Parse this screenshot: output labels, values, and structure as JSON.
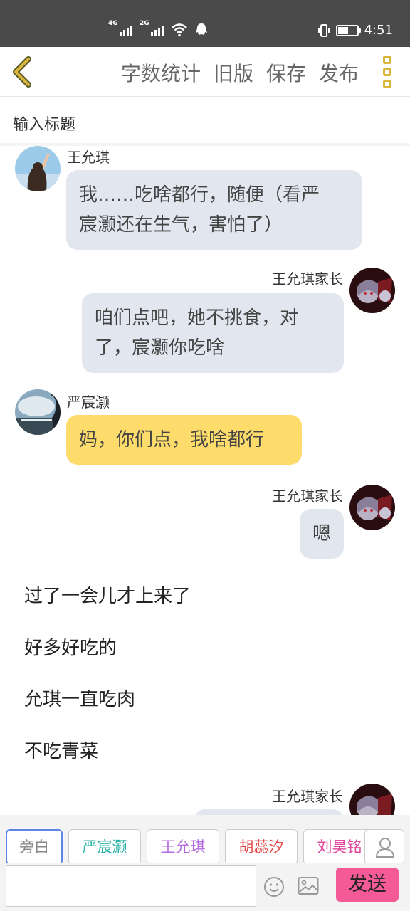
{
  "status_bar": {
    "sim1": "4G",
    "sim2": "2G",
    "time": "4:51",
    "battery_level": 0.55
  },
  "toolbar": {
    "back_icon": "chevron-left-icon",
    "word_count": "字数统计",
    "old_version": "旧版",
    "save": "保存",
    "publish": "发布",
    "more_icon": "more-vertical-icon",
    "accent_color": "#d9b53b"
  },
  "title_input": {
    "placeholder": "输入标题"
  },
  "chat": {
    "messages": [
      {
        "sender": "王允琪",
        "side": "left",
        "text_lines": [
          "我……吃啥都行，随便（看严",
          "宸灏还在生气，害怕了）"
        ],
        "bubble_color": "#e2e7ef"
      },
      {
        "sender": "王允琪家长",
        "side": "right",
        "text_lines": [
          "咱们点吧，她不挑食，对",
          "了，宸灏你吃啥"
        ],
        "bubble_color": "#e2e7ef"
      },
      {
        "sender": "严宸灏",
        "side": "left",
        "text_lines": [
          "妈，你们点，我啥都行"
        ],
        "bubble_color": "#fddc6c"
      },
      {
        "sender": "王允琪家长",
        "side": "right",
        "text_lines": [
          "嗯"
        ],
        "bubble_color": "#e2e7ef"
      }
    ],
    "narration": [
      "过了一会儿才上来了",
      "好多好吃的",
      "允琪一直吃肉",
      "不吃青菜"
    ],
    "last_sender": "王允琪家长"
  },
  "roles": {
    "items": [
      {
        "label": "旁白",
        "color": "#888888"
      },
      {
        "label": "严宸灏",
        "color": "#2bb3a8"
      },
      {
        "label": "王允琪",
        "color": "#b36be0"
      },
      {
        "label": "胡蕊汐",
        "color": "#e34a4a"
      },
      {
        "label": "刘昊铭",
        "color": "#e0469a"
      }
    ],
    "person_icon": "person-icon"
  },
  "composer": {
    "input_value": "",
    "emoji_icon": "smiley-icon",
    "image_icon": "image-icon",
    "send_label": "发送",
    "send_color": "#f45a96"
  }
}
